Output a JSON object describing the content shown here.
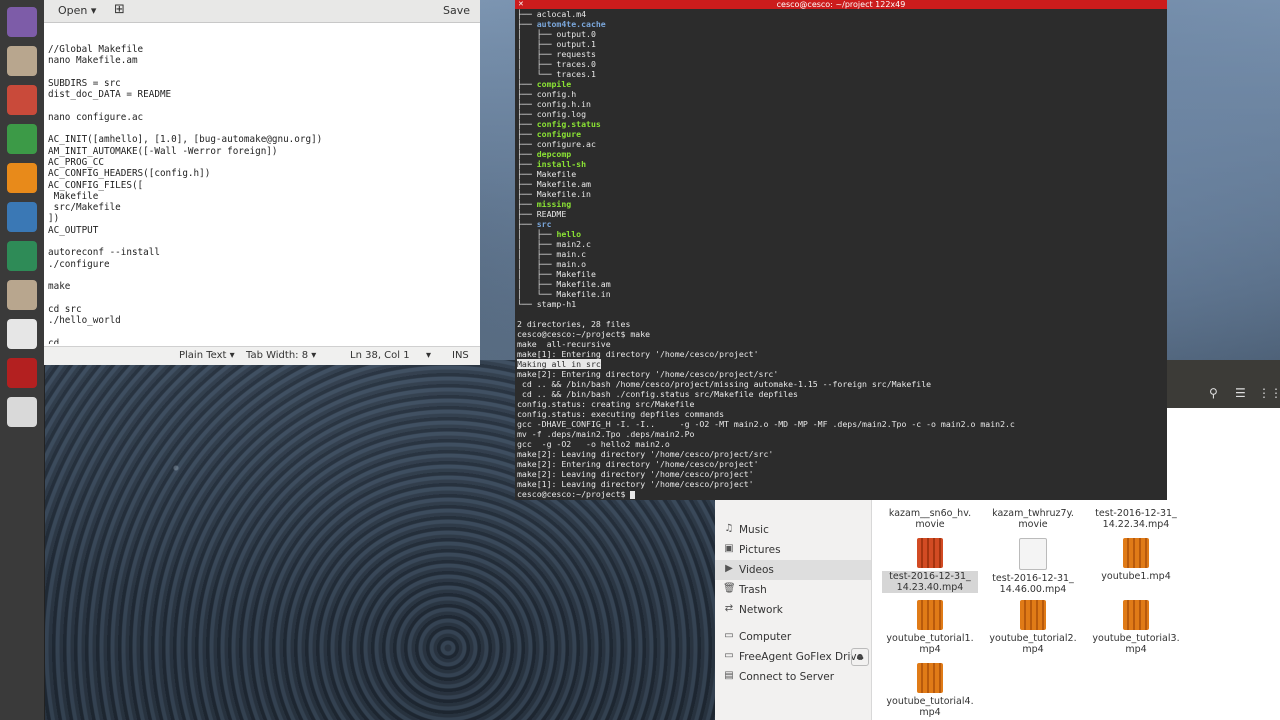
{
  "gedit": {
    "open_label": "Open",
    "save_label": "Save",
    "content": "//Global Makefile\nnano Makefile.am\n\nSUBDIRS = src\ndist_doc_DATA = README\n\nnano configure.ac\n\nAC_INIT([amhello], [1.0], [bug-automake@gnu.org])\nAM_INIT_AUTOMAKE([-Wall -Werror foreign])\nAC_PROG_CC\nAC_CONFIG_HEADERS([config.h])\nAC_CONFIG_FILES([\n Makefile\n src/Makefile\n])\nAC_OUTPUT\n\nautoreconf --install\n./configure\n\nmake\n\ncd src\n./hello_world\n\ncd",
    "status": {
      "language": "Plain Text",
      "tab_width": "Tab Width: 8",
      "position": "Ln 38, Col 1",
      "mode": "INS"
    }
  },
  "terminal": {
    "title": "cesco@cesco: ~/project 122x49",
    "lines": [
      {
        "text": "├── aclocal.m4",
        "style": "normal"
      },
      {
        "text": "├── autom4te.cache",
        "style": "dir"
      },
      {
        "text": "│   ├── output.0",
        "style": "normal"
      },
      {
        "text": "│   ├── output.1",
        "style": "normal"
      },
      {
        "text": "│   ├── requests",
        "style": "normal"
      },
      {
        "text": "│   ├── traces.0",
        "style": "normal"
      },
      {
        "text": "│   └── traces.1",
        "style": "normal"
      },
      {
        "text": "├── compile",
        "style": "exe"
      },
      {
        "text": "├── config.h",
        "style": "normal"
      },
      {
        "text": "├── config.h.in",
        "style": "normal"
      },
      {
        "text": "├── config.log",
        "style": "normal"
      },
      {
        "text": "├── config.status",
        "style": "exe"
      },
      {
        "text": "├── configure",
        "style": "exe"
      },
      {
        "text": "├── configure.ac",
        "style": "normal"
      },
      {
        "text": "├── depcomp",
        "style": "exe"
      },
      {
        "text": "├── install-sh",
        "style": "exe"
      },
      {
        "text": "├── Makefile",
        "style": "normal"
      },
      {
        "text": "├── Makefile.am",
        "style": "normal"
      },
      {
        "text": "├── Makefile.in",
        "style": "normal"
      },
      {
        "text": "├── missing",
        "style": "exe"
      },
      {
        "text": "├── README",
        "style": "normal"
      },
      {
        "text": "├── src",
        "style": "dir"
      },
      {
        "text": "│   ├── hello",
        "style": "exe"
      },
      {
        "text": "│   ├── main2.c",
        "style": "normal"
      },
      {
        "text": "│   ├── main.c",
        "style": "normal"
      },
      {
        "text": "│   ├── main.o",
        "style": "normal"
      },
      {
        "text": "│   ├── Makefile",
        "style": "normal"
      },
      {
        "text": "│   ├── Makefile.am",
        "style": "normal"
      },
      {
        "text": "│   └── Makefile.in",
        "style": "normal"
      },
      {
        "text": "└── stamp-h1",
        "style": "normal"
      },
      {
        "text": "",
        "style": "normal"
      },
      {
        "text": "2 directories, 28 files",
        "style": "normal"
      },
      {
        "text": "cesco@cesco:~/project$ make",
        "style": "normal"
      },
      {
        "text": "make  all-recursive",
        "style": "normal"
      },
      {
        "text": "make[1]: Entering directory '/home/cesco/project'",
        "style": "normal"
      },
      {
        "text": "Making all in src",
        "style": "hl"
      },
      {
        "text": "make[2]: Entering directory '/home/cesco/project/src'",
        "style": "normal"
      },
      {
        "text": " cd .. && /bin/bash /home/cesco/project/missing automake-1.15 --foreign src/Makefile",
        "style": "normal"
      },
      {
        "text": " cd .. && /bin/bash ./config.status src/Makefile depfiles",
        "style": "normal"
      },
      {
        "text": "config.status: creating src/Makefile",
        "style": "normal"
      },
      {
        "text": "config.status: executing depfiles commands",
        "style": "normal"
      },
      {
        "text": "gcc -DHAVE_CONFIG_H -I. -I..     -g -O2 -MT main2.o -MD -MP -MF .deps/main2.Tpo -c -o main2.o main2.c",
        "style": "normal"
      },
      {
        "text": "mv -f .deps/main2.Tpo .deps/main2.Po",
        "style": "normal"
      },
      {
        "text": "gcc  -g -O2   -o hello2 main2.o",
        "style": "normal"
      },
      {
        "text": "make[2]: Leaving directory '/home/cesco/project/src'",
        "style": "normal"
      },
      {
        "text": "make[2]: Entering directory '/home/cesco/project'",
        "style": "normal"
      },
      {
        "text": "make[2]: Leaving directory '/home/cesco/project'",
        "style": "normal"
      },
      {
        "text": "make[1]: Leaving directory '/home/cesco/project'",
        "style": "normal"
      },
      {
        "text": "cesco@cesco:~/project$ ",
        "style": "prompt"
      }
    ]
  },
  "launcher": {
    "items": [
      {
        "name": "dash-home-icon",
        "color": "#7d5ca8"
      },
      {
        "name": "files-icon",
        "color": "#b8a68e"
      },
      {
        "name": "system-settings-icon",
        "color": "#c94a3a"
      },
      {
        "name": "chrome-icon",
        "color": "#3c9a47"
      },
      {
        "name": "vlc-icon",
        "color": "#e88a1a"
      },
      {
        "name": "thunderbird-icon",
        "color": "#3a78b5"
      },
      {
        "name": "globe-icon",
        "color": "#2e8b57"
      },
      {
        "name": "files-icon-2",
        "color": "#b8a68e"
      },
      {
        "name": "text-editor-icon",
        "color": "#e6e6e6"
      },
      {
        "name": "screen-recorder-icon",
        "color": "#b32020"
      },
      {
        "name": "usb-drive-icon",
        "color": "#d9d9d9"
      }
    ]
  },
  "files": {
    "sidebar": [
      {
        "label": "Music",
        "icon": "music-icon",
        "glyph": "♫"
      },
      {
        "label": "Pictures",
        "icon": "pictures-icon",
        "glyph": "▣"
      },
      {
        "label": "Videos",
        "icon": "videos-icon",
        "glyph": "▶"
      },
      {
        "label": "Trash",
        "icon": "trash-icon",
        "glyph": "🗑"
      },
      {
        "label": "Network",
        "icon": "network-icon",
        "glyph": "⇄"
      },
      {
        "label": "Computer",
        "icon": "computer-icon",
        "glyph": "▭"
      },
      {
        "label": "FreeAgent GoFlex Drive",
        "icon": "drive-icon",
        "glyph": "▭"
      },
      {
        "label": "Connect to Server",
        "icon": "server-icon",
        "glyph": "▤"
      }
    ],
    "items": [
      {
        "line1": "kazam__sn6o_hv.",
        "line2": "movie",
        "type": "none"
      },
      {
        "line1": "kazam_twhruz7y.",
        "line2": "movie",
        "type": "none"
      },
      {
        "line1": "test-2016-12-31_",
        "line2": "14.22.34.mp4",
        "type": "none"
      },
      {
        "line1": "test-2016-12-31_",
        "line2": "14.23.40.mp4",
        "type": "video-red"
      },
      {
        "line1": "test-2016-12-31_",
        "line2": "14.46.00.mp4",
        "type": "doc"
      },
      {
        "line1": "youtube1.mp4",
        "line2": "",
        "type": "video"
      },
      {
        "line1": "youtube_tutorial1.",
        "line2": "mp4",
        "type": "video"
      },
      {
        "line1": "youtube_tutorial2.",
        "line2": "mp4",
        "type": "video"
      },
      {
        "line1": "youtube_tutorial3.",
        "line2": "mp4",
        "type": "video"
      },
      {
        "line1": "youtube_tutorial4.",
        "line2": "mp4",
        "type": "video"
      }
    ]
  }
}
